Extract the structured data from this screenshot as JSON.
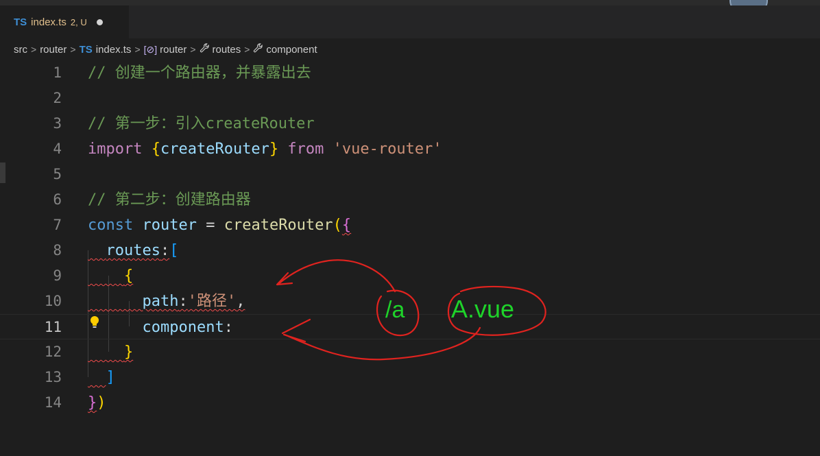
{
  "tab": {
    "lang_badge": "TS",
    "file_name": "index.ts",
    "status": "2, U"
  },
  "breadcrumb": {
    "items": [
      "src",
      "router",
      "index.ts",
      "router",
      "routes",
      "component"
    ],
    "ts_badge": "TS",
    "separator": ">",
    "icons": [
      "variable-icon",
      "wrench-icon",
      "wrench-icon"
    ]
  },
  "editor": {
    "line_numbers": [
      "1",
      "2",
      "3",
      "4",
      "5",
      "6",
      "7",
      "8",
      "9",
      "10",
      "11",
      "12",
      "13",
      "14"
    ],
    "current_line": "11",
    "lines": {
      "l1": {
        "comment": "// 创建一个路由器，并暴露出去"
      },
      "l3": {
        "comment": "// 第一步：引入createRouter"
      },
      "l4": {
        "kw": "import",
        "sp": " ",
        "ob": "{",
        "name": "createRouter",
        "cb": "}",
        "from": " from ",
        "str": "'vue-router'"
      },
      "l6": {
        "comment": "// 第二步：创建路由器"
      },
      "l7": {
        "kw": "const",
        "sp": " ",
        "var": "router",
        "eq": " = ",
        "fn": "createRouter",
        "op": "(",
        "ob": "{"
      },
      "l8": {
        "indent": "  ",
        "key": "routes",
        "colon": ":",
        "ob": "["
      },
      "l9": {
        "indent": "    ",
        "ob": "{"
      },
      "l10": {
        "indent": "      ",
        "key": "path",
        "colon": ":",
        "str": "'路径'",
        "comma": ","
      },
      "l11": {
        "indent": "      ",
        "key": "component",
        "colon": ":"
      },
      "l12": {
        "indent": "    ",
        "cb": "}"
      },
      "l13": {
        "indent": "  ",
        "cb": "]"
      },
      "l14": {
        "cb": "}",
        "cp": ")"
      }
    }
  },
  "annotations": {
    "text_a": "/a",
    "text_b": "A.vue",
    "colors": {
      "ink": "#e0231f",
      "green": "#1ed32a"
    }
  },
  "colors": {
    "background": "#1e1e1e",
    "tab_bar": "#252526",
    "comment": "#6a9955",
    "keyword": "#569cd6",
    "string": "#ce9178",
    "function": "#dcdcaa",
    "variable": "#9cdcfe"
  }
}
